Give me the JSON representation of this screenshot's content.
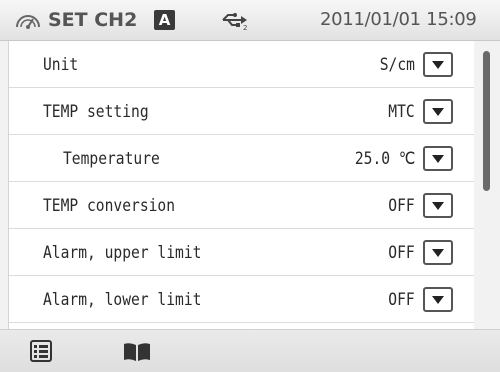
{
  "header": {
    "title": "SET CH2",
    "mode_badge": "A",
    "datetime": "2011/01/01 15:09",
    "icons": [
      "gauge-icon",
      "usb-icon"
    ]
  },
  "settings": [
    {
      "label": "Unit",
      "value": "S/cm",
      "indented": false
    },
    {
      "label": "TEMP setting",
      "value": "MTC",
      "indented": false
    },
    {
      "label": "Temperature",
      "value": "25.0 ℃",
      "indented": true
    },
    {
      "label": "TEMP conversion",
      "value": "OFF",
      "indented": false
    },
    {
      "label": "Alarm, upper limit",
      "value": "OFF",
      "indented": false
    },
    {
      "label": "Alarm, lower limit",
      "value": "OFF",
      "indented": false
    }
  ],
  "footer": {
    "icons": [
      "list-icon",
      "book-icon"
    ]
  },
  "colors": {
    "background": "#f2f2f2",
    "list_background": "#ffffff",
    "text": "#2a2a2a",
    "header_text": "#555555",
    "badge": "#3a3a3a",
    "scroll_thumb": "#6a6a6a"
  }
}
